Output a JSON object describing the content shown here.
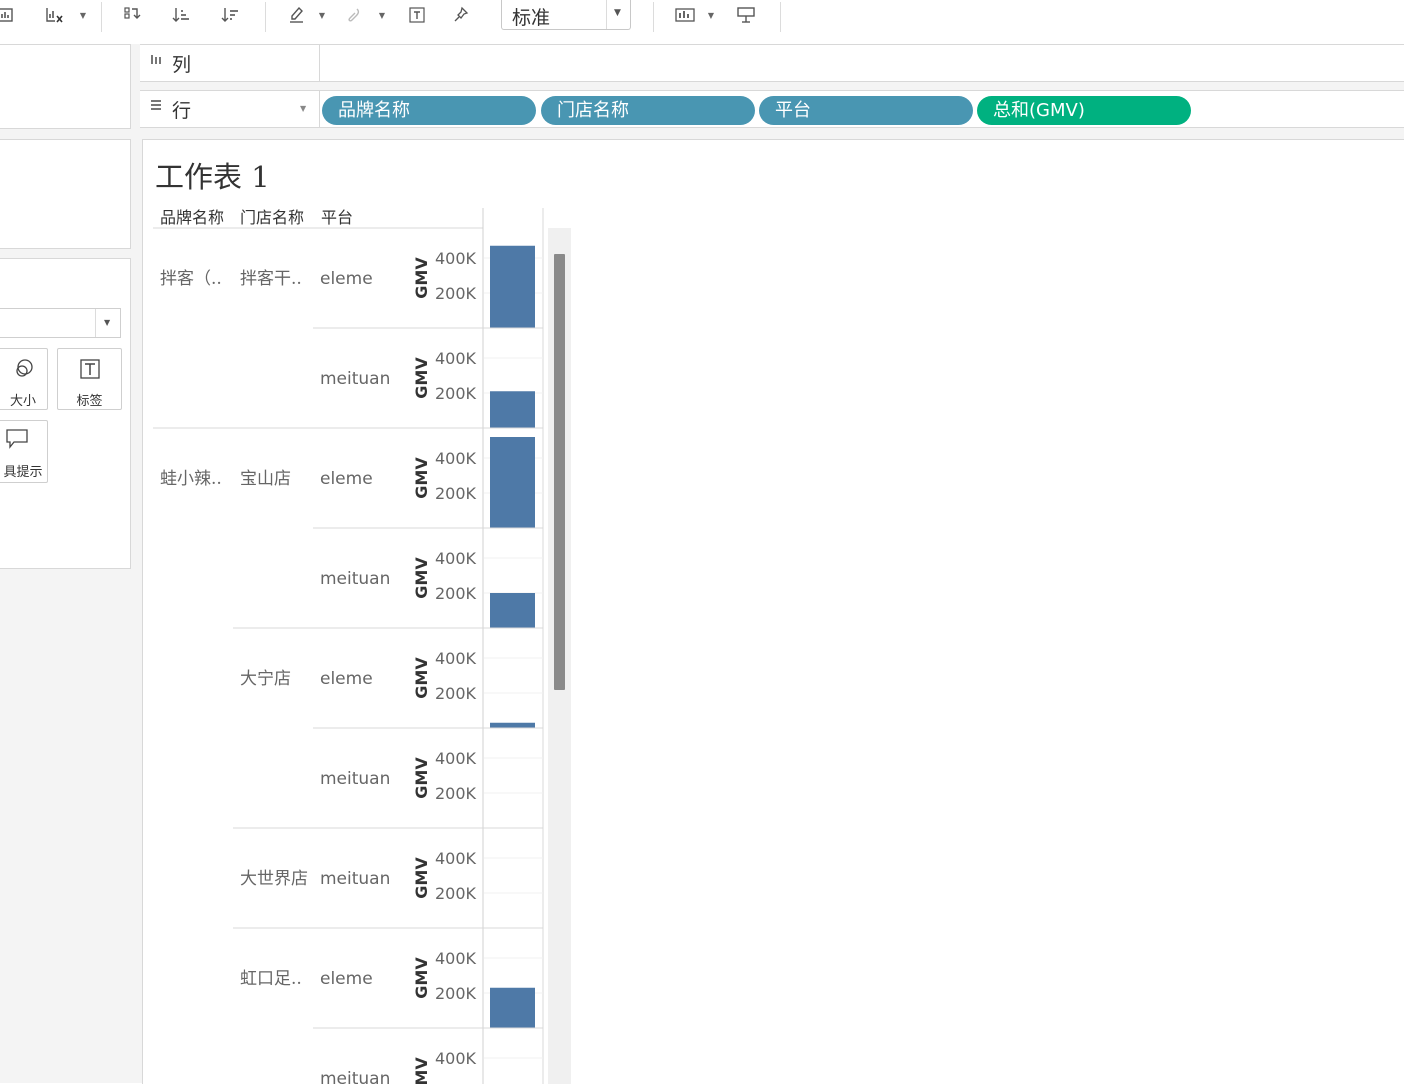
{
  "toolbar": {
    "fit_value": "标准",
    "icons": [
      "chart-icon",
      "clear-sheet-icon",
      "swap-icon",
      "sort-ascending-icon",
      "sort-descending-icon",
      "highlight-icon",
      "group-icon",
      "text-label-icon",
      "pin-icon",
      "show-me-icon",
      "presentation-icon"
    ]
  },
  "marks": {
    "size_label": "大小",
    "label_label": "标签",
    "tooltip_label": "具提示"
  },
  "shelves": {
    "columns_label": "列",
    "rows_label": "行",
    "row_pills": [
      {
        "label": "品牌名称",
        "color": "#4996b2"
      },
      {
        "label": "门店名称",
        "color": "#4996b2"
      },
      {
        "label": "平台",
        "color": "#4996b2"
      },
      {
        "label": "总和(GMV)",
        "color": "#00b180"
      }
    ]
  },
  "sheet": {
    "title": "工作表 1",
    "headers": [
      "品牌名称",
      "门店名称",
      "平台"
    ]
  },
  "chart_data": {
    "type": "bar",
    "orientation": "vertical-panels",
    "measure": "GMV",
    "axis_label": "GMV",
    "ticks": [
      "200K",
      "400K"
    ],
    "ylim": [
      0,
      480000
    ],
    "bar_color": "#4e79a7",
    "rows": [
      {
        "brand": "拌客（..",
        "store": "拌客干..",
        "platform": "eleme",
        "value": 470000
      },
      {
        "brand": "",
        "store": "",
        "platform": "meituan",
        "value": 210000
      },
      {
        "brand": "蛙小辣..",
        "store": "宝山店",
        "platform": "eleme",
        "value": 520000
      },
      {
        "brand": "",
        "store": "",
        "platform": "meituan",
        "value": 200000
      },
      {
        "brand": "",
        "store": "大宁店",
        "platform": "eleme",
        "value": 30000
      },
      {
        "brand": "",
        "store": "",
        "platform": "meituan",
        "value": 0
      },
      {
        "brand": "",
        "store": "大世界店",
        "platform": "meituan",
        "value": 0
      },
      {
        "brand": "",
        "store": "虹口足..",
        "platform": "eleme",
        "value": 230000
      },
      {
        "brand": "",
        "store": "",
        "platform": "meituan",
        "value": 0
      }
    ]
  }
}
